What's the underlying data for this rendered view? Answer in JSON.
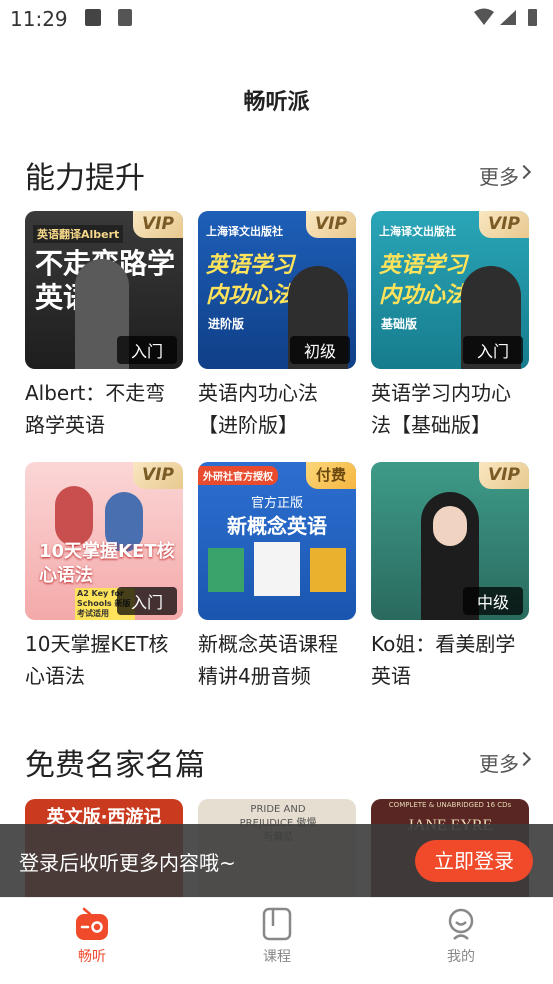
{
  "status_bar": {
    "time": "11:29"
  },
  "header": {
    "title": "畅听派"
  },
  "section1": {
    "title": "能力提升",
    "more": "更多"
  },
  "section2": {
    "title": "免费名家名篇",
    "more": "更多"
  },
  "cards": [
    {
      "title": "Albert：不走弯路学英语",
      "badge": "VIP",
      "level": "入门",
      "cover_top": "英语翻译Albert",
      "cover_big": "不走弯路学英语"
    },
    {
      "title": "英语内功心法【进阶版】",
      "badge": "VIP",
      "level": "初级",
      "cover_top": "上海译文出版社",
      "cover_big": "英语学习内功心法",
      "cover_sub": "进阶版"
    },
    {
      "title": "英语学习内功心法【基础版】",
      "badge": "VIP",
      "level": "入门",
      "cover_top": "上海译文出版社",
      "cover_big": "英语学习内功心法",
      "cover_sub": "基础版"
    },
    {
      "title": "10天掌握KET核心语法",
      "badge": "VIP",
      "level": "入门",
      "cover_big": "10天掌握KET核心语法",
      "cover_sub": "A2 Key for Schools 新版考试适用"
    },
    {
      "title": "新概念英语课程精讲4册音频",
      "badge": "付费",
      "cover_top": "外研社官方授权",
      "cover_mid": "官方正版",
      "cover_big": "新概念英语"
    },
    {
      "title": "Ko姐：看美剧学英语",
      "badge": "VIP",
      "level": "中级"
    }
  ],
  "books": [
    {
      "cover": "英文版·西游记"
    },
    {
      "cover": "PRIDE AND PREJUDICE 傲慢与偏见"
    },
    {
      "cover": "JANE EYRE",
      "cover_top": "COMPLETE & UNABRIDGED 16 CDs"
    }
  ],
  "login_prompt": {
    "text": "登录后收听更多内容哦~",
    "button": "立即登录"
  },
  "tabbar": {
    "items": [
      {
        "label": "畅听",
        "icon": "radio-icon"
      },
      {
        "label": "课程",
        "icon": "course-icon"
      },
      {
        "label": "我的",
        "icon": "profile-icon"
      }
    ]
  },
  "colors": {
    "accent": "#f04a2b"
  }
}
